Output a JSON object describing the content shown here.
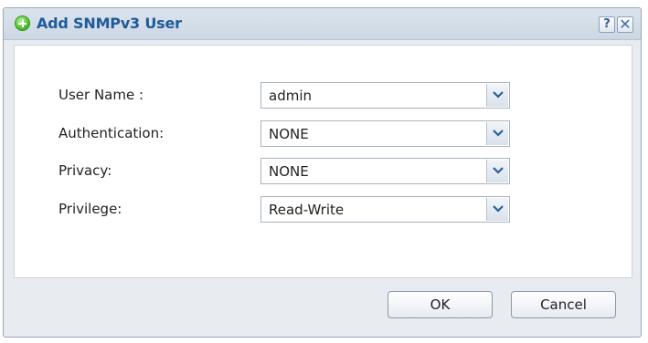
{
  "dialog": {
    "title": "Add SNMPv3 User",
    "icon": "add-icon",
    "help_label": "?",
    "close_label": "✕"
  },
  "form": {
    "fields": [
      {
        "label": "User Name :",
        "value": "admin"
      },
      {
        "label": "Authentication:",
        "value": "NONE"
      },
      {
        "label": "Privacy:",
        "value": "NONE"
      },
      {
        "label": "Privilege:",
        "value": "Read-Write"
      }
    ]
  },
  "buttons": {
    "ok": "OK",
    "cancel": "Cancel"
  },
  "colors": {
    "title_text": "#1f5a99",
    "dialog_bg": "#e8ecf1",
    "panel_bg": "#ffffff"
  }
}
